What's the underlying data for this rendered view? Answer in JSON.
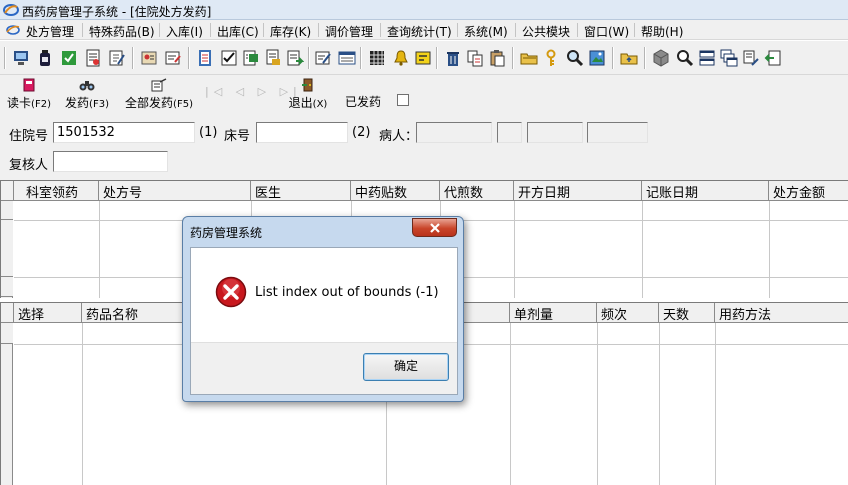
{
  "window": {
    "title": "西药房管理子系统 - [住院处方发药]"
  },
  "menu": [
    "处方管理",
    "特殊药品(B)",
    "入库(I)",
    "出库(C)",
    "库存(K)",
    "调价管理",
    "查询统计(T)",
    "系统(M)",
    "公共模块",
    "窗口(W)",
    "帮助(H)"
  ],
  "actions": {
    "read_card": {
      "label": "读卡",
      "key": "(F2)"
    },
    "dispense": {
      "label": "发药",
      "key": "(F3)"
    },
    "dispense_all": {
      "label": "全部发药",
      "key": "(F5)"
    },
    "exit": {
      "label": "退出",
      "key": "(X)"
    },
    "dispensed_label": "已发药"
  },
  "form": {
    "inpatient_no_label": "住院号",
    "inpatient_no_value": "1501532",
    "marker_1": "(1)",
    "bed_no_label": "床号",
    "bed_no_value": "",
    "marker_2": "(2)",
    "patient_label": "病人：",
    "reviewer_label": "复核人",
    "reviewer_value": ""
  },
  "prescription_grid": {
    "columns": [
      "科室领药",
      "处方号",
      "医生",
      "中药贴数",
      "代煎数",
      "开方日期",
      "记账日期",
      "处方金额"
    ]
  },
  "drug_grid": {
    "columns": [
      "选择",
      "药品名称",
      "",
      "单剂量",
      "频次",
      "天数",
      "用药方法"
    ]
  },
  "dialog": {
    "title": "药房管理系统",
    "message": "List index out of bounds (-1)",
    "ok_label": "确定"
  },
  "colors": {
    "titlebar": "#dfe9f5",
    "dialog_frame": "#c6d9ee",
    "error_icon": "#c8181e",
    "close_button": "#c9452a"
  }
}
